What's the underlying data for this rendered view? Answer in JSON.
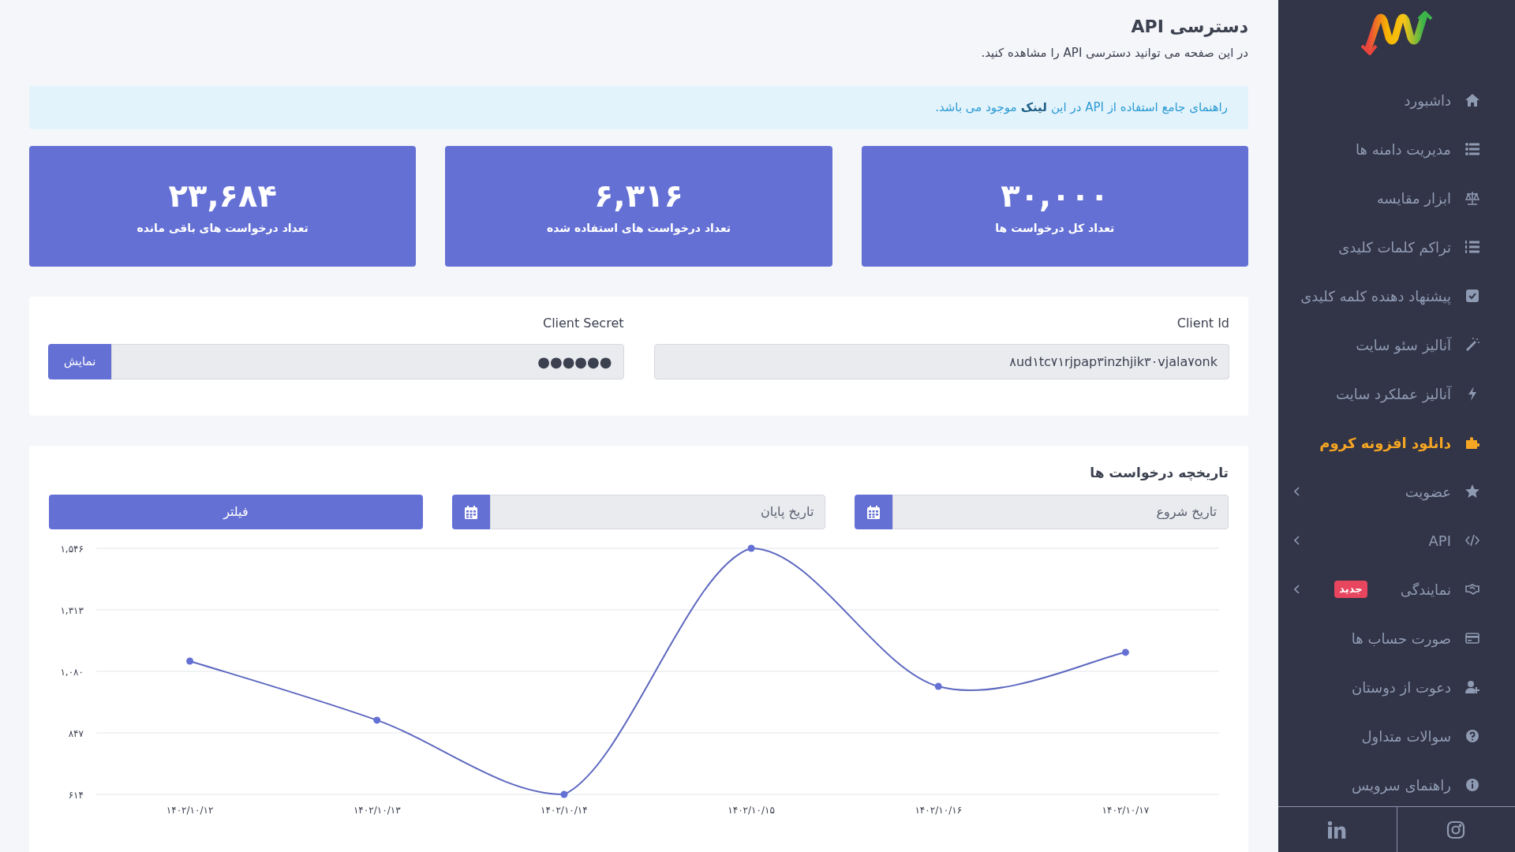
{
  "page": {
    "title": "دسترسی API",
    "subtitle": "در این صفحه می توانید دسترسی API را مشاهده کنید."
  },
  "alert": {
    "before": "راهنمای جامع استفاده از API در این",
    "link": "لینک",
    "after": "موجود می باشد."
  },
  "stats": [
    {
      "value": "۳۰,۰۰۰",
      "label": "تعداد کل درخواست ها"
    },
    {
      "value": "۶,۳۱۶",
      "label": "تعداد درخواست های استفاده شده"
    },
    {
      "value": "۲۳,۶۸۴",
      "label": "تعداد درخواست های باقی مانده"
    }
  ],
  "credentials": {
    "client_id": {
      "label": "Client Id",
      "value": "۸ud۱tc۷۱rjpap۳inzhjik۳۰vjala۷onk"
    },
    "client_secret": {
      "label": "Client Secret",
      "value": "●●●●●●",
      "button": "نمایش"
    }
  },
  "history": {
    "title": "تاریخچه درخواست ها",
    "start": {
      "placeholder": "تاریخ شروع"
    },
    "end": {
      "placeholder": "تاریخ پایان"
    },
    "filter": "فیلتر",
    "chart_data": {
      "type": "line",
      "grid": true,
      "marker": true,
      "categories": [
        "۱۴۰۲/۱۰/۱۲",
        "۱۴۰۲/۱۰/۱۳",
        "۱۴۰۲/۱۰/۱۴",
        "۱۴۰۲/۱۰/۱۵",
        "۱۴۰۲/۱۰/۱۶",
        "۱۴۰۲/۱۰/۱۷"
      ],
      "values": [
        1119,
        895,
        614,
        1546,
        1023,
        1152
      ],
      "ylim": [
        614,
        1546
      ],
      "yticks": [
        {
          "value": 614,
          "label": "۶۱۴"
        },
        {
          "value": 847,
          "label": "۸۴۷"
        },
        {
          "value": 1080,
          "label": "۱,۰۸۰"
        },
        {
          "value": 1313,
          "label": "۱,۳۱۳"
        },
        {
          "value": 1546,
          "label": "۱,۵۴۶"
        }
      ]
    }
  },
  "sidebar": {
    "items": [
      {
        "label": "داشبورد",
        "selected": false,
        "has_submenu": false
      },
      {
        "label": "مدیریت دامنه ها",
        "selected": false,
        "has_submenu": false
      },
      {
        "label": "ابزار مقایسه",
        "selected": false,
        "has_submenu": false
      },
      {
        "label": "تراکم کلمات کلیدی",
        "selected": false,
        "has_submenu": false
      },
      {
        "label": "پیشنهاد دهنده کلمه کلیدی",
        "selected": false,
        "has_submenu": false
      },
      {
        "label": "آنالیز سئو سایت",
        "selected": false,
        "has_submenu": false
      },
      {
        "label": "آنالیز عملکرد سایت",
        "selected": false,
        "has_submenu": false
      },
      {
        "label": "دانلود افزونه کروم",
        "selected": true,
        "has_submenu": false
      },
      {
        "label": "عضویت",
        "selected": false,
        "has_submenu": true
      },
      {
        "label": "API",
        "selected": false,
        "has_submenu": true
      },
      {
        "label": "نمایندگی",
        "selected": false,
        "has_submenu": true,
        "badge": "جدید"
      },
      {
        "label": "صورت حساب ها",
        "selected": false,
        "has_submenu": false
      },
      {
        "label": "دعوت از دوستان",
        "selected": false,
        "has_submenu": false
      },
      {
        "label": "سوالات متداول",
        "selected": false,
        "has_submenu": false
      },
      {
        "label": "راهنمای سرویس",
        "selected": false,
        "has_submenu": false
      }
    ]
  }
}
